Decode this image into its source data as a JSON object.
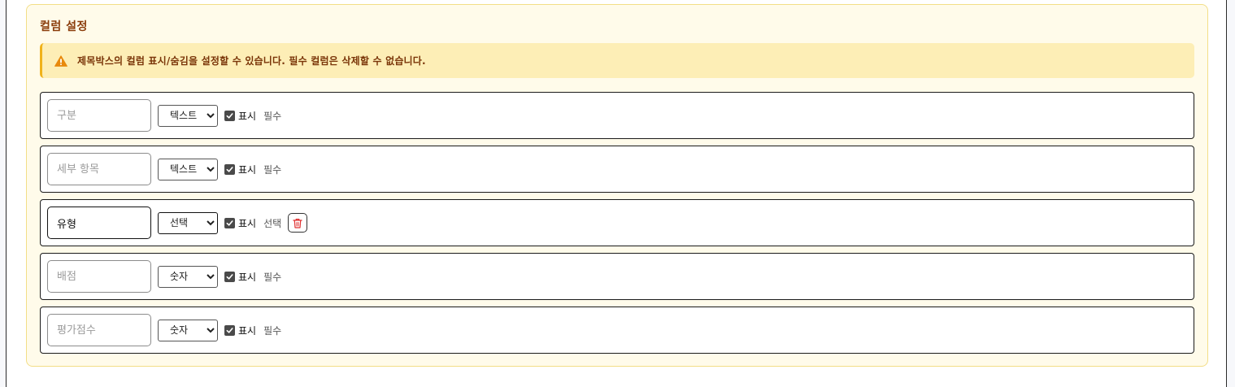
{
  "section": {
    "title": "컬럼 설정",
    "notice": "제목박스의 컬럼 표시/숨김을 설정할 수 있습니다. 필수 컬럼은 삭제할 수 없습니다."
  },
  "columns": [
    {
      "name": "",
      "placeholder": "구분",
      "type": "텍스트",
      "visible": true,
      "visible_label": "표시",
      "requirement": "필수",
      "deletable": false
    },
    {
      "name": "",
      "placeholder": "세부 항목",
      "type": "텍스트",
      "visible": true,
      "visible_label": "표시",
      "requirement": "필수",
      "deletable": false
    },
    {
      "name": "유형",
      "placeholder": "",
      "type": "선택",
      "visible": true,
      "visible_label": "표시",
      "requirement": "선택",
      "deletable": true
    },
    {
      "name": "",
      "placeholder": "배점",
      "type": "숫자",
      "visible": true,
      "visible_label": "표시",
      "requirement": "필수",
      "deletable": false
    },
    {
      "name": "",
      "placeholder": "평가점수",
      "type": "숫자",
      "visible": true,
      "visible_label": "표시",
      "requirement": "필수",
      "deletable": false
    }
  ],
  "icons": {
    "warning": "warning-icon",
    "check": "check-icon",
    "delete": "trash-icon"
  },
  "colors": {
    "panel_bg": "#fffbea",
    "notice_bg": "#fdeeb6",
    "accent": "#f0b21b",
    "title": "#8a3c0a",
    "delete": "#e03131"
  }
}
